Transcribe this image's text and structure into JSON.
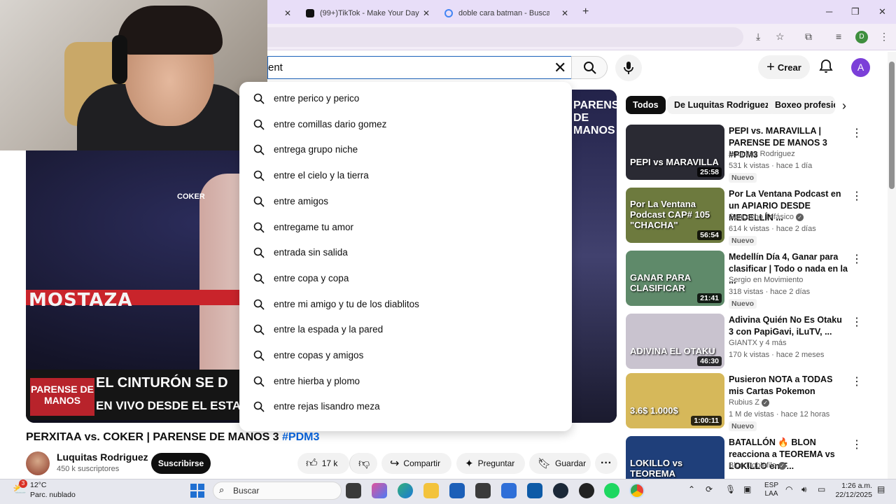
{
  "browser": {
    "tabs": [
      {
        "title": "(99+)TikTok - Make Your Day",
        "icon": "tiktok-icon"
      },
      {
        "title": "doble cara batman - Buscar con",
        "icon": "google-icon"
      }
    ],
    "new_tab": "+",
    "profile_initial": "D"
  },
  "youtube": {
    "search": {
      "value": "ent",
      "placeholder": "Buscar"
    },
    "create_label": "Crear",
    "avatar_initial": "A",
    "suggestions": [
      "entre perico y perico",
      "entre comillas dario gomez",
      "entrega grupo niche",
      "entre el cielo y la tierra",
      "entre amigos",
      "entregame tu amor",
      "entrada sin salida",
      "entre copa y copa",
      "entre mi amigo y tu de los diablitos",
      "entre la espada y la pared",
      "entre copas y amigos",
      "entre hierba y plomo",
      "entre rejas lisandro meza"
    ],
    "player": {
      "ring_text": "MOSTAZA",
      "overlay_logo": "PARENSE DE MANOS",
      "overlay_line1": "EL CINTURÓN SE D",
      "overlay_line2": "EN VIVO DESDE EL ESTA",
      "right_logo": "PARENSE DE MANOS",
      "sign": "COKER"
    },
    "video": {
      "title": "PERXITAA vs. COKER | PARENSE DE MANOS 3 ",
      "hashtag": "#PDM3",
      "channel": "Luquitas Rodriguez",
      "subscribers": "450 k suscriptores",
      "subscribe_label": "Suscribirse",
      "likes": "17 k",
      "share_label": "Compartir",
      "ask_label": "Preguntar",
      "save_label": "Guardar"
    },
    "chips": [
      "Todos",
      "De Luquitas Rodriguez",
      "Boxeo profesio"
    ],
    "recommendations": [
      {
        "title": "PEPI vs. MARAVILLA | PARENSE DE MANOS 3 #PDM3",
        "channel": "Luquitas Rodriguez",
        "verified": false,
        "meta": "531 k vistas · hace 1 día",
        "badge": "Nuevo",
        "duration": "25:58",
        "thumb_text": "PEPI vs MARAVILLA",
        "thumb_color": "#2a2a33"
      },
      {
        "title": "Por La Ventana Podcast en un APIARIO DESDE MEDELLÍN ...",
        "channel": "Sancocho Trifásico",
        "verified": true,
        "meta": "614 k vistas · hace 2 días",
        "badge": "Nuevo",
        "duration": "56:54",
        "thumb_text": "Por La Ventana Podcast CAP# 105 \"CHACHA\"",
        "thumb_color": "#6d7a3e"
      },
      {
        "title": "Medellín Día 4, Ganar para clasificar | Todo o nada en la ...",
        "channel": "Sergio en Movimiento",
        "verified": false,
        "meta": "318 vistas · hace 2 días",
        "badge": "Nuevo",
        "duration": "21:41",
        "thumb_text": "GANAR PARA CLASIFICAR",
        "thumb_color": "#5f8a6a"
      },
      {
        "title": "Adivina Quién No Es Otaku 3 con PapiGavi, iLuTV, ...",
        "channel": "GIANTX y 4 más",
        "verified": false,
        "meta": "170 k vistas · hace 2 meses",
        "badge": "",
        "duration": "46:30",
        "thumb_text": "ADIVINA EL OTAKU",
        "thumb_color": "#c9c3cf"
      },
      {
        "title": "Pusieron NOTA a TODAS mis Cartas Pokemon",
        "channel": "Rubius Z",
        "verified": true,
        "meta": "1 M de vistas · hace 12 horas",
        "badge": "Nuevo",
        "duration": "1:00:11",
        "thumb_text": "3.6$ 1.000$",
        "thumb_color": "#d6b85a"
      },
      {
        "title": "BATALLÓN 🔥 BLON reacciona a TEOREMA vs LOKILLO en F...",
        "channel": "Blon Doblefilo",
        "verified": true,
        "meta": "",
        "badge": "",
        "duration": "",
        "thumb_text": "LOKILLO vs TEOREMA",
        "thumb_color": "#1f3f7a"
      }
    ]
  },
  "taskbar": {
    "weather_temp": "12°C",
    "weather_desc": "Parc. nublado",
    "weather_badge": "3",
    "search_label": "Buscar",
    "lang_line1": "ESP",
    "lang_line2": "LAA",
    "time": "1:26 a.m.",
    "date": "22/12/2025"
  },
  "colors": {
    "accent": "#065fd4",
    "tab_bg": "#e8def8",
    "avatar": "#7b3fd8"
  }
}
